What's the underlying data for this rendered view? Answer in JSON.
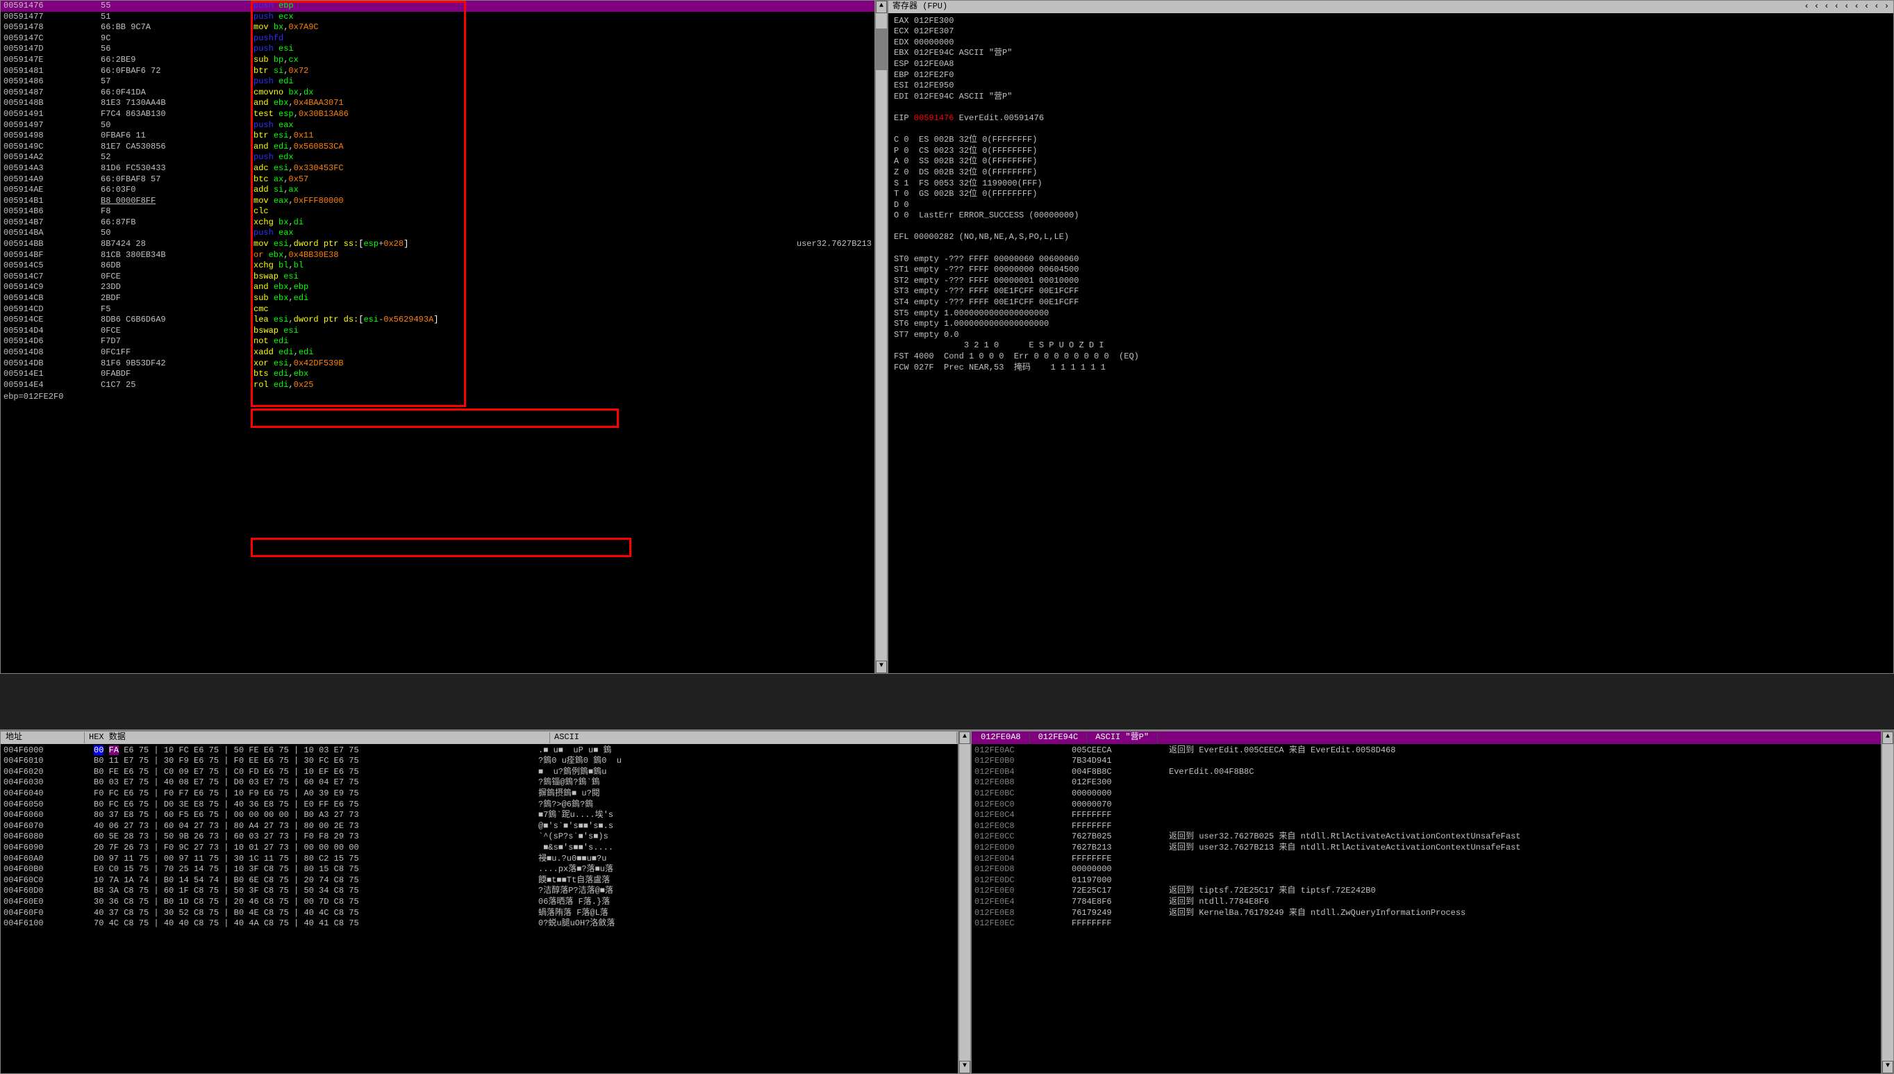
{
  "disasm": {
    "status": "ebp=012FE2F0",
    "comment_row_idx": 22,
    "comment_text": "user32.7627B213",
    "highlight_idx": 0,
    "redbox_small1_idx": 22,
    "redbox_small2_idx": 29,
    "rows": [
      {
        "addr": "00591476",
        "bytes": "55",
        "m": "push",
        "ops": "ebp",
        "cls": "push"
      },
      {
        "addr": "00591477",
        "bytes": "51",
        "m": "push",
        "ops": "ecx",
        "cls": "push"
      },
      {
        "addr": "00591478",
        "bytes": "66:BB 9C7A",
        "m": "mov",
        "ops": "bx,0x7A9C",
        "cls": "mov"
      },
      {
        "addr": "0059147C",
        "bytes": "9C",
        "m": "pushfd",
        "ops": "",
        "cls": "push"
      },
      {
        "addr": "0059147D",
        "bytes": "56",
        "m": "push",
        "ops": "esi",
        "cls": "push"
      },
      {
        "addr": "0059147E",
        "bytes": "66:2BE9",
        "m": "sub",
        "ops": "bp,cx",
        "cls": "def"
      },
      {
        "addr": "00591481",
        "bytes": "66:0FBAF6 72",
        "m": "btr",
        "ops": "si,0x72",
        "cls": "def"
      },
      {
        "addr": "00591486",
        "bytes": "57",
        "m": "push",
        "ops": "edi",
        "cls": "push"
      },
      {
        "addr": "00591487",
        "bytes": "66:0F41DA",
        "m": "cmovno",
        "ops": "bx,dx",
        "cls": "def"
      },
      {
        "addr": "0059148B",
        "bytes": "81E3 7130AA4B",
        "m": "and",
        "ops": "ebx,0x4BAA3071",
        "cls": "def"
      },
      {
        "addr": "00591491",
        "bytes": "F7C4 863AB130",
        "m": "test",
        "ops": "esp,0x30B13A86",
        "cls": "def"
      },
      {
        "addr": "00591497",
        "bytes": "50",
        "m": "push",
        "ops": "eax",
        "cls": "push"
      },
      {
        "addr": "00591498",
        "bytes": "0FBAF6 11",
        "m": "btr",
        "ops": "esi,0x11",
        "cls": "def"
      },
      {
        "addr": "0059149C",
        "bytes": "81E7 CA530856",
        "m": "and",
        "ops": "edi,0x560853CA",
        "cls": "def"
      },
      {
        "addr": "005914A2",
        "bytes": "52",
        "m": "push",
        "ops": "edx",
        "cls": "push"
      },
      {
        "addr": "005914A3",
        "bytes": "81D6 FC530433",
        "m": "adc",
        "ops": "esi,0x330453FC",
        "cls": "def"
      },
      {
        "addr": "005914A9",
        "bytes": "66:0FBAF8 57",
        "m": "btc",
        "ops": "ax,0x57",
        "cls": "def"
      },
      {
        "addr": "005914AE",
        "bytes": "66:03F0",
        "m": "add",
        "ops": "si,ax",
        "cls": "def"
      },
      {
        "addr": "005914B1",
        "bytes": "B8 0000F8FF",
        "m": "mov",
        "ops": "eax,0xFFF80000",
        "cls": "mov",
        "u": true
      },
      {
        "addr": "005914B6",
        "bytes": "F8",
        "m": "clc",
        "ops": "",
        "cls": "def"
      },
      {
        "addr": "005914B7",
        "bytes": "66:87FB",
        "m": "xchg",
        "ops": "bx,di",
        "cls": "def"
      },
      {
        "addr": "005914BA",
        "bytes": "50",
        "m": "push",
        "ops": "eax",
        "cls": "push"
      },
      {
        "addr": "005914BB",
        "bytes": "8B7424 28",
        "m": "mov",
        "ops": "esi,dword ptr ss:[esp+0x28]",
        "cls": "mov",
        "mem": true
      },
      {
        "addr": "005914BF",
        "bytes": "81CB 380EB34B",
        "m": "or",
        "ops": "ebx,0x4BB30E38",
        "cls": "or"
      },
      {
        "addr": "005914C5",
        "bytes": "86DB",
        "m": "xchg",
        "ops": "bl,bl",
        "cls": "def"
      },
      {
        "addr": "005914C7",
        "bytes": "0FCE",
        "m": "bswap",
        "ops": "esi",
        "cls": "def"
      },
      {
        "addr": "005914C9",
        "bytes": "23DD",
        "m": "and",
        "ops": "ebx,ebp",
        "cls": "def"
      },
      {
        "addr": "005914CB",
        "bytes": "2BDF",
        "m": "sub",
        "ops": "ebx,edi",
        "cls": "def"
      },
      {
        "addr": "005914CD",
        "bytes": "F5",
        "m": "cmc",
        "ops": "",
        "cls": "def"
      },
      {
        "addr": "005914CE",
        "bytes": "8DB6 C6B6D6A9",
        "m": "lea",
        "ops": "esi,dword ptr ds:[esi-0x5629493A]",
        "cls": "mov",
        "mem": true
      },
      {
        "addr": "005914D4",
        "bytes": "0FCE",
        "m": "bswap",
        "ops": "esi",
        "cls": "def"
      },
      {
        "addr": "005914D6",
        "bytes": "F7D7",
        "m": "not",
        "ops": "edi",
        "cls": "def"
      },
      {
        "addr": "005914D8",
        "bytes": "0FC1FF",
        "m": "xadd",
        "ops": "edi,edi",
        "cls": "def"
      },
      {
        "addr": "005914DB",
        "bytes": "81F6 9B53DF42",
        "m": "xor",
        "ops": "esi,0x42DF539B",
        "cls": "def"
      },
      {
        "addr": "005914E1",
        "bytes": "0FABDF",
        "m": "bts",
        "ops": "edi,ebx",
        "cls": "def"
      },
      {
        "addr": "005914E4",
        "bytes": "C1C7 25",
        "m": "rol",
        "ops": "edi,0x25",
        "cls": "def"
      }
    ]
  },
  "registers": {
    "title": "寄存器 (FPU)",
    "arrows": "‹     ‹     ‹     ‹     ‹     ‹     ‹     ‹     ›",
    "gpr": [
      {
        "name": "EAX",
        "val": "012FE300"
      },
      {
        "name": "ECX",
        "val": "012FE307"
      },
      {
        "name": "EDX",
        "val": "00000000"
      },
      {
        "name": "EBX",
        "val": "012FE94C",
        "extra": "ASCII \"营P\""
      },
      {
        "name": "ESP",
        "val": "012FE0A8"
      },
      {
        "name": "EBP",
        "val": "012FE2F0"
      },
      {
        "name": "ESI",
        "val": "012FE950"
      },
      {
        "name": "EDI",
        "val": "012FE94C",
        "extra": "ASCII \"营P\""
      }
    ],
    "eip": {
      "name": "EIP",
      "val": "00591476",
      "comment": "EverEdit.00591476"
    },
    "flags": [
      "C 0  ES 002B 32位 0(FFFFFFFF)",
      "P 0  CS 0023 32位 0(FFFFFFFF)",
      "A 0  SS 002B 32位 0(FFFFFFFF)",
      "Z 0  DS 002B 32位 0(FFFFFFFF)",
      "S 1  FS 0053 32位 1199000(FFF)",
      "T 0  GS 002B 32位 0(FFFFFFFF)",
      "D 0",
      "O 0  LastErr ERROR_SUCCESS (00000000)"
    ],
    "efl": "EFL 00000282 (NO,NB,NE,A,S,PO,L,LE)",
    "fpu": [
      "ST0 empty -??? FFFF 00000060 00600060",
      "ST1 empty -??? FFFF 00000000 00604500",
      "ST2 empty -??? FFFF 00000001 00010000",
      "ST3 empty -??? FFFF 00E1FCFF 00E1FCFF",
      "ST4 empty -??? FFFF 00E1FCFF 00E1FCFF",
      "ST5 empty 1.0000000000000000000",
      "ST6 empty 1.0000000000000000000",
      "ST7 empty 0.0"
    ],
    "fpu_status": [
      "              3 2 1 0      E S P U O Z D I",
      "FST 4000  Cond 1 0 0 0  Err 0 0 0 0 0 0 0 0  (EQ)",
      "FCW 027F  Prec NEAR,53  掩码    1 1 1 1 1 1"
    ]
  },
  "hex": {
    "h1": "地址",
    "h2": "HEX 数据",
    "h3": "ASCII",
    "rows": [
      {
        "a": "004F6000",
        "b": "00 FA E6 75 | 10 FC E6 75 | 50 FE E6 75 | 10 03 E7 75",
        "t": ".■ u■  uP u■ 鎢",
        "hl": "FA"
      },
      {
        "a": "004F6010",
        "b": "B0 11 E7 75 | 30 F9 E6 75 | F0 EE E6 75 | 30 FC E6 75",
        "t": "?鎢0 u痊鎢0 鎢0  u"
      },
      {
        "a": "004F6020",
        "b": "B0 FE E6 75 | C0 09 E7 75 | C0 FD E6 75 | 10 EF E6 75",
        "t": "■  u?鎢例鎢■鎢u"
      },
      {
        "a": "004F6030",
        "b": "B0 03 E7 75 | 40 08 E7 75 | D0 03 E7 75 | 60 04 E7 75",
        "t": "?鎢锱@鎢?鎢`鎢"
      },
      {
        "a": "004F6040",
        "b": "F0 FC E6 75 | F0 F7 E6 75 | 10 F9 E6 75 | A0 39 E9 75",
        "t": "摒鎢摂鎢■ u?閱"
      },
      {
        "a": "004F6050",
        "b": "B0 FC E6 75 | D0 3E E8 75 | 40 36 E8 75 | E0 FF E6 75",
        "t": "?鎢?>@6鎢?鎢"
      },
      {
        "a": "004F6060",
        "b": "80 37 E8 75 | 60 F5 E6 75 | 00 00 00 00 | B0 A3 27 73",
        "t": "■7鎢`跜u....埃's"
      },
      {
        "a": "004F6070",
        "b": "40 06 27 73 | 60 04 27 73 | 80 A4 27 73 | 80 00 2E 73",
        "t": "@■'s`■'s■■'s■.s"
      },
      {
        "a": "004F6080",
        "b": "60 5E 28 73 | 50 9B 26 73 | 60 03 27 73 | F0 F8 29 73",
        "t": "`^(sP?s`■'s■)s"
      },
      {
        "a": "004F6090",
        "b": "20 7F 26 73 | F0 9C 27 73 | 10 01 27 73 | 00 00 00 00",
        "t": " ■&s■'s■■'s...."
      },
      {
        "a": "004F60A0",
        "b": "D0 97 11 75 | 00 97 11 75 | 30 1C 11 75 | 80 C2 15 75",
        "t": "祲■u.?u0■■u■?u"
      },
      {
        "a": "004F60B0",
        "b": "E0 C0 15 75 | 70 25 14 75 | 10 3F C8 75 | 80 15 C8 75",
        "t": "....px落■?落■u落"
      },
      {
        "a": "004F60C0",
        "b": "10 7A 1A 74 | B0 14 54 74 | B0 6E C8 75 | 20 74 C8 75",
        "t": "餪■t■■Tt自落盧落"
      },
      {
        "a": "004F60D0",
        "b": "B8 3A C8 75 | 60 1F C8 75 | 50 3F C8 75 | 50 34 C8 75",
        "t": "?洁醇落P?洁落@■落"
      },
      {
        "a": "004F60E0",
        "b": "30 36 C8 75 | B0 1D C8 75 | 20 46 C8 75 | 00 7D C8 75",
        "t": "06落晒落 F落.}落"
      },
      {
        "a": "004F60F0",
        "b": "40 37 C8 75 | 30 52 C8 75 | B0 4E C8 75 | 40 4C C8 75",
        "t": "蝸落陏落 F落@L落"
      },
      {
        "a": "004F6100",
        "b": "70 4C C8 75 | 40 40 C8 75 | 40 4A C8 75 | 40 41 C8 75",
        "t": "0?蜕u腿uOH?洛斂落"
      }
    ]
  },
  "stack": {
    "header": [
      "012FE0A8",
      "012FE94C",
      "ASCII \"营P\""
    ],
    "rows": [
      {
        "a": "012FE0AC",
        "v": "005CEECA",
        "c": "返回到 EverEdit.005CEECA 来自 EverEdit.0058D468"
      },
      {
        "a": "012FE0B0",
        "v": "7B34D941",
        "c": ""
      },
      {
        "a": "012FE0B4",
        "v": "004F8B8C",
        "c": "EverEdit.004F8B8C"
      },
      {
        "a": "012FE0B8",
        "v": "012FE300",
        "c": ""
      },
      {
        "a": "012FE0BC",
        "v": "00000000",
        "c": ""
      },
      {
        "a": "012FE0C0",
        "v": "00000070",
        "c": ""
      },
      {
        "a": "012FE0C4",
        "v": "FFFFFFFF",
        "c": ""
      },
      {
        "a": "012FE0C8",
        "v": "FFFFFFFF",
        "c": ""
      },
      {
        "a": "012FE0CC",
        "v": "7627B025",
        "c": "返回到 user32.7627B025 来自 ntdll.RtlActivateActivationContextUnsafeFast"
      },
      {
        "a": "012FE0D0",
        "v": "7627B213",
        "c": "返回到 user32.7627B213 来自 ntdll.RtlActivateActivationContextUnsafeFast"
      },
      {
        "a": "012FE0D4",
        "v": "FFFFFFFE",
        "c": ""
      },
      {
        "a": "012FE0D8",
        "v": "00000000",
        "c": ""
      },
      {
        "a": "012FE0DC",
        "v": "01197000",
        "c": ""
      },
      {
        "a": "012FE0E0",
        "v": "72E25C17",
        "c": "返回到 tiptsf.72E25C17 来自 tiptsf.72E242B0"
      },
      {
        "a": "012FE0E4",
        "v": "7784E8F6",
        "c": "返回到 ntdll.7784E8F6"
      },
      {
        "a": "012FE0E8",
        "v": "76179249",
        "c": "返回到 KernelBa.76179249 来自 ntdll.ZwQueryInformationProcess"
      },
      {
        "a": "012FE0EC",
        "v": "FFFFFFFF",
        "c": ""
      }
    ]
  }
}
